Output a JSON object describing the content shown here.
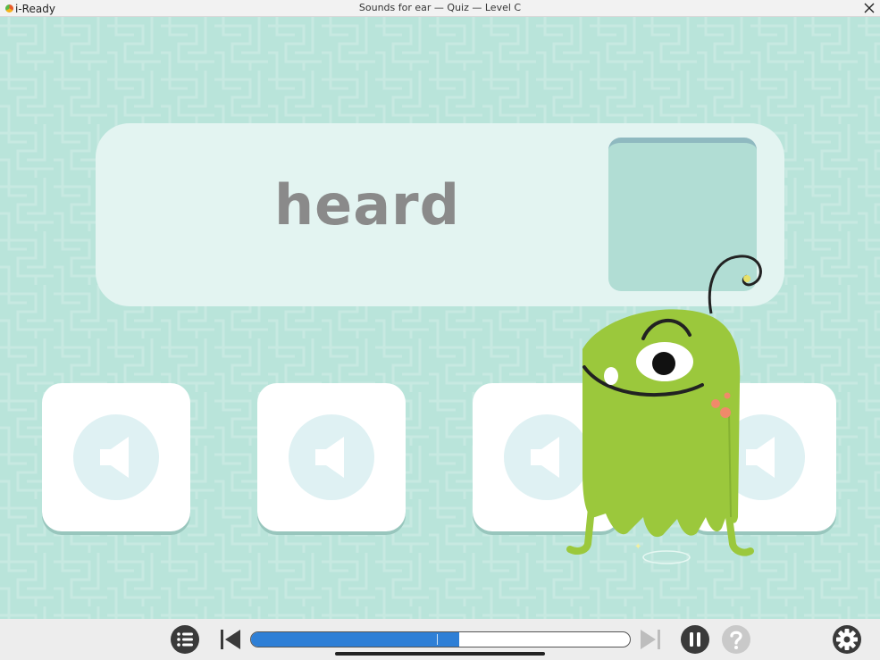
{
  "window": {
    "app_name": "i-Ready",
    "title": "Sounds for ear — Quiz — Level C",
    "close_icon": "close-icon"
  },
  "lesson": {
    "word": "heard",
    "answer_slot": "empty",
    "choices": [
      {
        "icon": "speaker-icon"
      },
      {
        "icon": "speaker-icon"
      },
      {
        "icon": "speaker-icon"
      },
      {
        "icon": "speaker-icon"
      }
    ],
    "character": "green-one-eyed-monster"
  },
  "toolbar": {
    "menu_icon": "list-icon",
    "prev_icon": "skip-back-icon",
    "next_icon": "skip-forward-icon",
    "pause_icon": "pause-icon",
    "help_icon": "help-icon",
    "settings_icon": "gear-icon",
    "progress": 0.55,
    "progress_marker": 0.49
  },
  "colors": {
    "background": "#b9e4da",
    "card": "#e3f4f1",
    "slot": "#b1ddd4",
    "progress_fill": "#2e7fd6",
    "monster": "#9bc83c"
  }
}
